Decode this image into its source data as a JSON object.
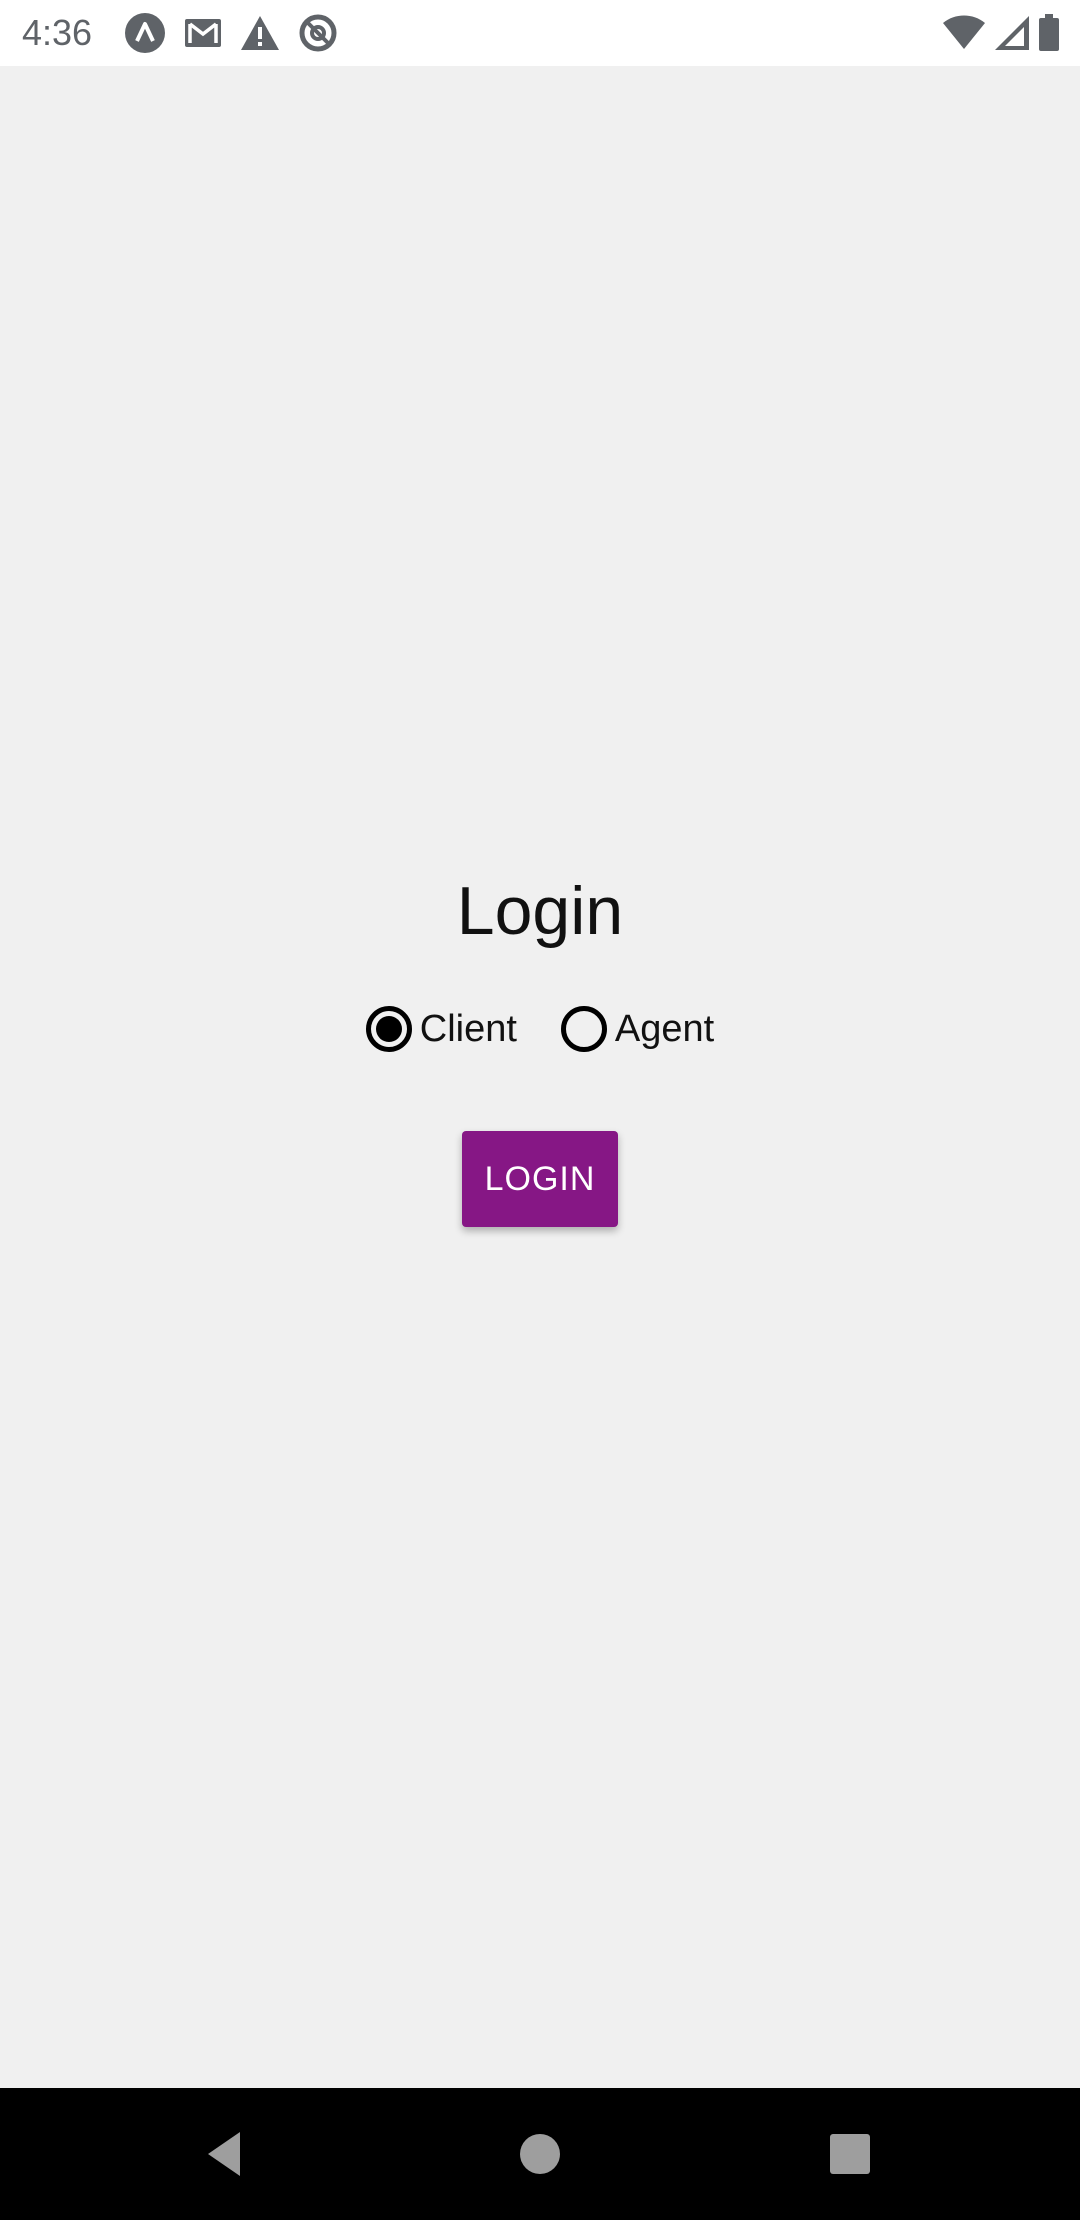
{
  "status_bar": {
    "time": "4:36",
    "notification_icons": [
      "app-a-icon",
      "gmail-icon",
      "warning-icon",
      "at-sign-icon"
    ],
    "system_icons": [
      "wifi-icon",
      "signal-icon",
      "battery-icon"
    ]
  },
  "screen": {
    "title": "Login",
    "radio_options": [
      {
        "label": "Client",
        "checked": true
      },
      {
        "label": "Agent",
        "checked": false
      }
    ],
    "login_button_label": "LOGIN",
    "accent_color": "#861785"
  },
  "nav_bar": {
    "buttons": [
      "back-icon",
      "home-icon",
      "recents-icon"
    ]
  }
}
